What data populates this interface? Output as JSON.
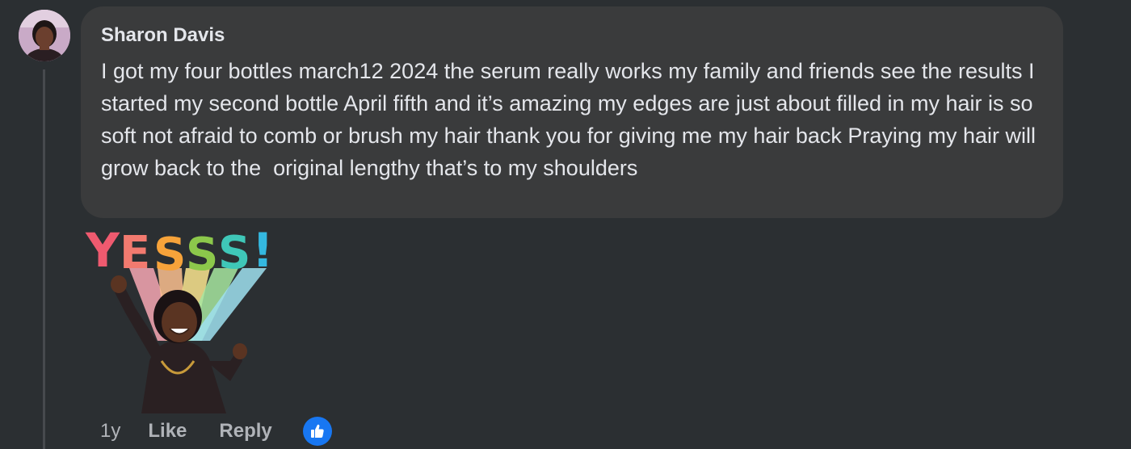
{
  "comment": {
    "author": "Sharon Davis",
    "text": "I got my four bottles march12 2024 the serum really works my family and friends see the results I started my second bottle April fifth and it’s amazing my edges are just about filled in my hair is so soft not afraid to comb or brush my hair thank you for giving me my hair back Praying my hair will grow back to the  original lengthy that’s to my shoulders",
    "sticker_text": "YESSS!",
    "actions": {
      "time": "1y",
      "like_label": "Like",
      "reply_label": "Reply"
    },
    "reaction_icon": "thumbs-up-icon"
  },
  "colors": {
    "background": "#2b2f32",
    "bubble": "#3a3b3c",
    "text": "#e4e6eb",
    "secondary_text": "#b0b3b8",
    "like_blue": "#1877f2"
  }
}
